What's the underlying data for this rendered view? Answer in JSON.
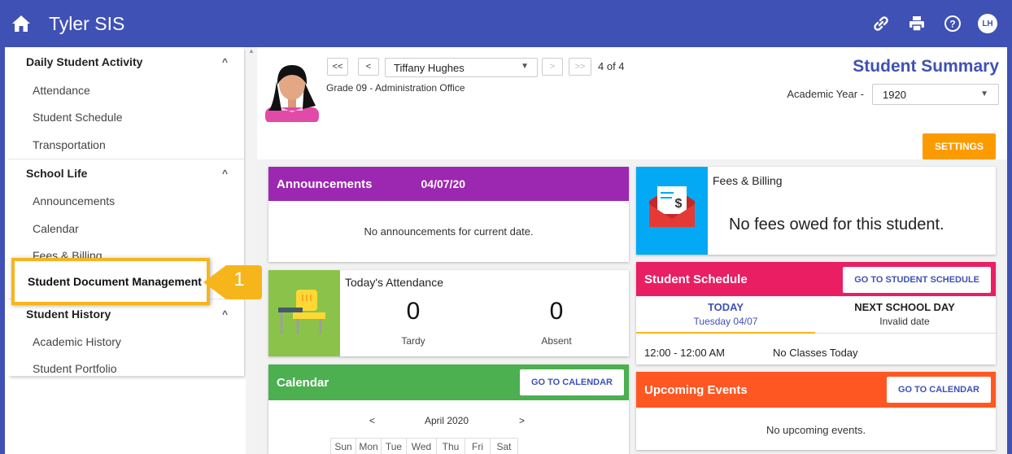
{
  "app": {
    "title": "Tyler SIS"
  },
  "header_icons": [
    "link-icon",
    "print-icon",
    "help-icon"
  ],
  "user_initials": "LH",
  "sidebar": {
    "sections": [
      {
        "title": "Daily Student Activity",
        "items": [
          "Attendance",
          "Student Schedule",
          "Transportation"
        ]
      },
      {
        "title": "School Life",
        "items": [
          "Announcements",
          "Calendar",
          "Fees & Billing"
        ]
      },
      {
        "title": "Student History",
        "items": [
          "Academic History",
          "Student Portfolio"
        ]
      }
    ],
    "highlighted_item": "Student Document Management",
    "callout_number": "1"
  },
  "student": {
    "nav_first": "<<",
    "nav_prev": "<",
    "nav_next": ">",
    "nav_last": ">>",
    "name": "Tiffany Hughes",
    "count": "4 of 4",
    "grade": "Grade 09 - Administration Office"
  },
  "summary": {
    "title": "Student Summary",
    "academic_year_label": "Academic Year -",
    "academic_year": "1920",
    "settings_label": "SETTINGS"
  },
  "announcements": {
    "title": "Announcements",
    "date": "04/07/20",
    "empty": "No announcements for current date."
  },
  "fees": {
    "title": "Fees & Billing",
    "message": "No fees owed for this student."
  },
  "attendance": {
    "title": "Today's Attendance",
    "tardy_value": "0",
    "tardy_label": "Tardy",
    "absent_value": "0",
    "absent_label": "Absent"
  },
  "schedule": {
    "title": "Student Schedule",
    "button": "GO TO STUDENT SCHEDULE",
    "tab_today": "TODAY",
    "tab_today_date": "Tuesday 04/07",
    "tab_next": "NEXT SCHOOL DAY",
    "tab_next_date": "Invalid date",
    "time": "12:00 - 12:00 AM",
    "class": "No Classes Today"
  },
  "calendar": {
    "title": "Calendar",
    "button": "GO TO CALENDAR",
    "prev": "<",
    "next": ">",
    "month": "April 2020",
    "days": [
      "Sun",
      "Mon",
      "Tue",
      "Wed",
      "Thu",
      "Fri",
      "Sat"
    ]
  },
  "events": {
    "title": "Upcoming Events",
    "button": "GO TO CALENDAR",
    "empty": "No upcoming events."
  },
  "colors": {
    "brand": "#3f51b5",
    "announcements": "#9c27b0",
    "schedule": "#e91e63",
    "calendar": "#4caf50",
    "events": "#ff5722",
    "fees_icon_bg": "#03a9f4",
    "attendance_icon_bg": "#8bc34a",
    "settings": "#fb9b00",
    "highlight": "#f7b51c"
  }
}
